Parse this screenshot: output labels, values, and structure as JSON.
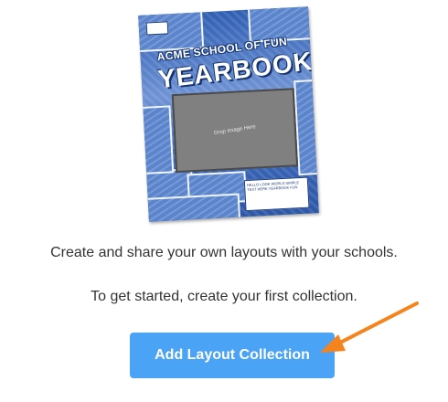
{
  "preview": {
    "school": "ACME SCHOOL OF FUN",
    "title": "YEARBOOK",
    "drop_text": "Drop Image Here",
    "speech_text": "HELLO LOOK WORLD SIMPLE TEXT HERE YEARBOOK FUN",
    "colors": {
      "cover_blue": "#3f6fbf",
      "drop_gray": "#808080"
    }
  },
  "message_line1": "Create and share your own layouts with your schools.",
  "message_line2": "To get started, create your first collection.",
  "add_button_label": "Add Layout Collection",
  "colors": {
    "button": "#4aa3f4",
    "arrow": "#f5841f",
    "text": "#333333"
  },
  "icons": {
    "arrow": "arrow-pointer-icon"
  }
}
